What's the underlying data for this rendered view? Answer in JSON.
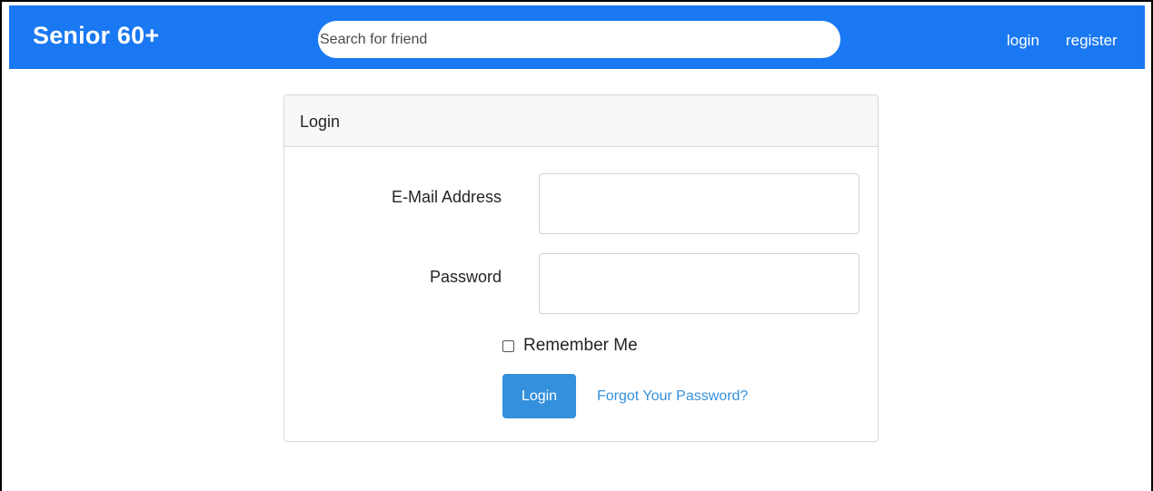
{
  "navbar": {
    "brand": "Senior 60+",
    "search_placeholder": "Search for friend",
    "search_value": "",
    "links": {
      "login": "login",
      "register": "register"
    }
  },
  "login_card": {
    "title": "Login",
    "email": {
      "label": "E-Mail Address",
      "value": ""
    },
    "password": {
      "label": "Password",
      "value": ""
    },
    "remember_label": "Remember Me",
    "remember_checked": false,
    "submit_label": "Login",
    "forgot_label": "Forgot Your Password?"
  },
  "colors": {
    "navbar": "#1a78f2",
    "primary": "#3490dc",
    "card_header": "#f7f7f7",
    "border": "#d9d9d9"
  }
}
